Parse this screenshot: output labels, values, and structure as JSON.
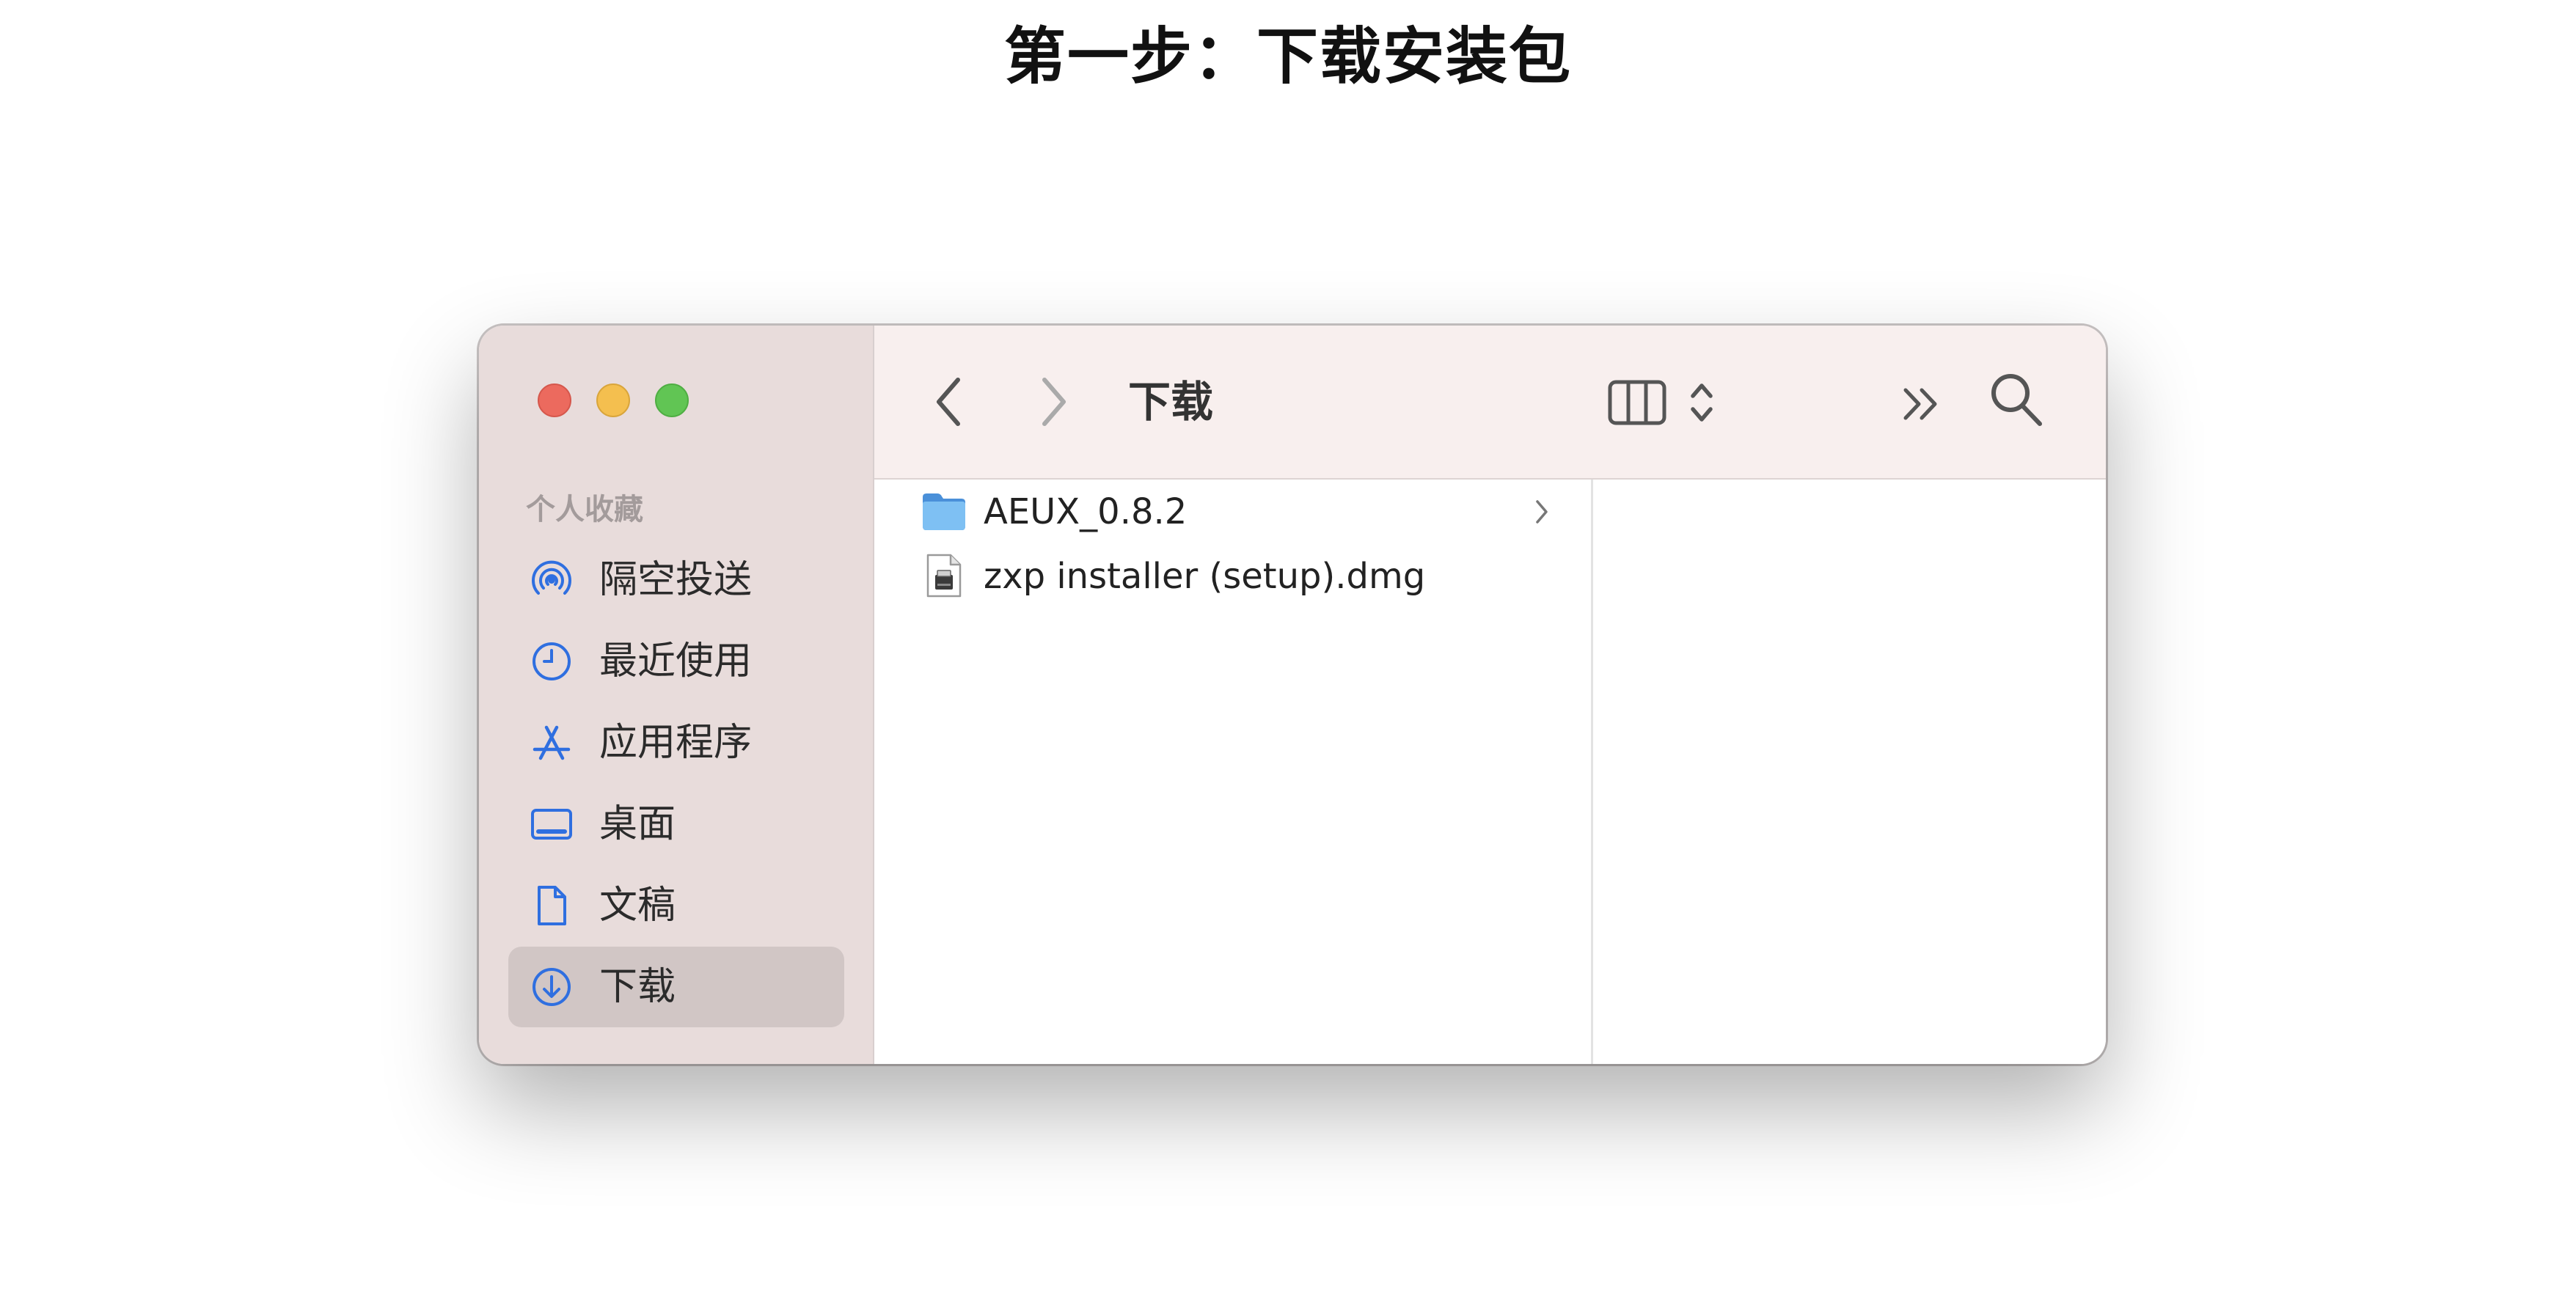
{
  "page": {
    "title": "第一步：下载安装包"
  },
  "window": {
    "traffic_lights": {
      "close": "#ec6a5e",
      "minimize": "#f4bf4f",
      "zoom": "#61c554"
    },
    "sidebar": {
      "section_header": "个人收藏",
      "items": [
        {
          "label": "隔空投送",
          "icon": "airdrop-icon"
        },
        {
          "label": "最近使用",
          "icon": "clock-icon"
        },
        {
          "label": "应用程序",
          "icon": "app-store-icon"
        },
        {
          "label": "桌面",
          "icon": "desktop-icon"
        },
        {
          "label": "文稿",
          "icon": "document-icon"
        },
        {
          "label": "下载",
          "icon": "download-icon",
          "selected": true
        }
      ],
      "accent_color": "#2f6fe0"
    },
    "toolbar": {
      "title": "下载",
      "back_icon": "chevron-left-icon",
      "forward_icon": "chevron-right-icon",
      "view_icon": "column-view-icon",
      "sort_icon": "up-down-chevron-icon",
      "more_icon": "double-chevron-icon",
      "search_icon": "magnifier-icon"
    },
    "files": [
      {
        "name": "AEUX_0.8.2",
        "kind": "folder",
        "icon": "folder-icon",
        "has_children": true
      },
      {
        "name": "zxp installer (setup).dmg",
        "kind": "disk-image",
        "icon": "dmg-file-icon",
        "has_children": false
      }
    ]
  }
}
